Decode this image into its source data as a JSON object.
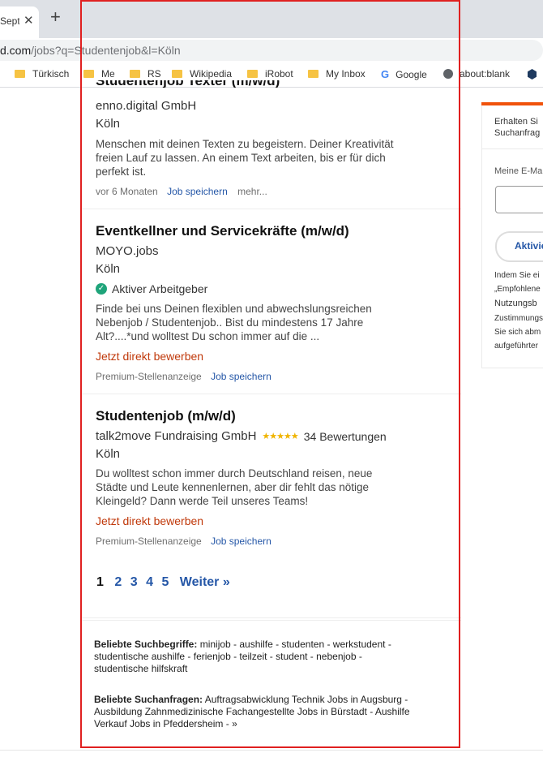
{
  "browser": {
    "tab_title": "Septe",
    "url_domain": "d.com",
    "url_path": "/jobs?q=Studentenjob&l=Köln",
    "bookmarks": [
      {
        "label": "Türkisch",
        "icon": "folder-icon"
      },
      {
        "label": "Me",
        "icon": "folder-icon"
      },
      {
        "label": "RS",
        "icon": "folder-icon"
      },
      {
        "label": "Wikipedia",
        "icon": "folder-icon"
      },
      {
        "label": "iRobot",
        "icon": "folder-icon"
      },
      {
        "label": "My Inbox",
        "icon": "folder-icon"
      },
      {
        "label": "Google",
        "icon": "google-icon"
      },
      {
        "label": "about:blank",
        "icon": "globe-icon"
      }
    ]
  },
  "jobs": [
    {
      "title_partial": "Studentenjob Texter (m/w/d)",
      "company": "enno.digital GmbH",
      "location": "Köln",
      "snippet": "Menschen mit deinen Texten zu begeistern. Deiner Kreativität freien Lauf zu lassen. An einem Text arbeiten, bis er für dich perfekt ist.",
      "age": "vor 6 Monaten",
      "save": "Job speichern",
      "more": "mehr..."
    },
    {
      "title": "Eventkellner und Servicekräfte (m/w/d)",
      "company": "MOYO.jobs",
      "location": "Köln",
      "employer_badge": "Aktiver Arbeitgeber",
      "snippet": "Finde bei uns Deinen flexiblen und abwechslungsreichen Nebenjob / Studentenjob.. Bist du mindestens 17 Jahre Alt?....*und wolltest Du schon immer auf die ...",
      "apply": "Jetzt direkt bewerben",
      "sponsored": "Premium-Stellenanzeige",
      "save": "Job speichern"
    },
    {
      "title": "Studentenjob (m/w/d)",
      "company": "talk2move Fundraising GmbH",
      "rating": 4.5,
      "reviews": "34 Bewertungen",
      "location": "Köln",
      "snippet": "Du wolltest schon immer durch Deutschland reisen, neue Städte und Leute kennenlernen, aber dir fehlt das nötige Kleingeld? Dann werde Teil unseres Teams!",
      "apply": "Jetzt direkt bewerben",
      "sponsored": "Premium-Stellenanzeige",
      "save": "Job speichern"
    }
  ],
  "pagination": {
    "current": "1",
    "pages": [
      "2",
      "3",
      "4",
      "5"
    ],
    "next": "Weiter »"
  },
  "footer": {
    "popular_terms_label": "Beliebte Suchbegriffe:",
    "popular_terms": "minijob - aushilfe - studenten - werkstudent - studentische aushilfe - ferienjob - teilzeit - student - nebenjob - studentische hilfskraft",
    "popular_queries_label": "Beliebte Suchanfragen:",
    "popular_queries": "Auftragsabwicklung Technik Jobs in Augsburg - Ausbildung Zahnmedizinische Fachangestellte Jobs in Bürstadt - Aushilfe Verkauf Jobs in Pfeddersheim - »"
  },
  "sidebar": {
    "intro_line1": "Erhalten Si",
    "intro_line2": "Suchanfrag",
    "email_label": "Meine E-Ma",
    "button": "Aktivie",
    "legal": [
      "Indem Sie ei",
      "„Empfohlene",
      "Nutzungsb",
      "Zustimmungs",
      "Sie sich abm",
      "aufgeführter"
    ]
  },
  "colors": {
    "link": "#2557a7",
    "apply": "#c0390b",
    "accent": "#f0520b",
    "badge": "#1fa47a",
    "star": "#f0b400"
  }
}
